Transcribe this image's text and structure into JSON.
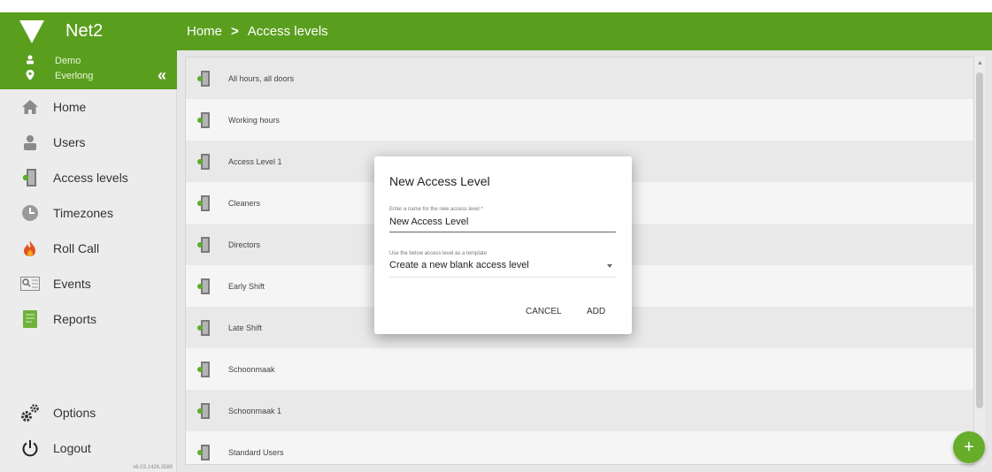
{
  "app": {
    "name": "Net2"
  },
  "breadcrumb": {
    "home": "Home",
    "separator": ">",
    "current": "Access levels"
  },
  "user": {
    "name": "Demo",
    "site": "Everlong",
    "collapse_glyph": "«"
  },
  "sidebar": {
    "items": [
      {
        "label": "Home",
        "icon": "home-icon"
      },
      {
        "label": "Users",
        "icon": "user-icon"
      },
      {
        "label": "Access levels",
        "icon": "door-icon"
      },
      {
        "label": "Timezones",
        "icon": "clock-icon"
      },
      {
        "label": "Roll Call",
        "icon": "fire-icon"
      },
      {
        "label": "Events",
        "icon": "events-icon"
      },
      {
        "label": "Reports",
        "icon": "report-icon"
      }
    ],
    "bottom_items": [
      {
        "label": "Options",
        "icon": "gears-icon"
      },
      {
        "label": "Logout",
        "icon": "power-icon"
      }
    ],
    "version": "v6.03.1426.3589"
  },
  "access_levels": [
    "All hours, all doors",
    "Working hours",
    "Access Level 1",
    "Cleaners",
    "Directors",
    "Early Shift",
    "Late Shift",
    "Schoonmaak",
    "Schoonmaak 1",
    "Standard Users"
  ],
  "fab": {
    "label": "+"
  },
  "dialog": {
    "title": "New Access Level",
    "name_label": "Enter a name for the new access level *",
    "name_value": "New Access Level",
    "template_label": "Use the below access level as a template",
    "template_value": "Create a new blank access level",
    "cancel": "CANCEL",
    "add": "ADD"
  },
  "colors": {
    "brand": "#5a9e1e",
    "fab": "#66ad2a"
  }
}
